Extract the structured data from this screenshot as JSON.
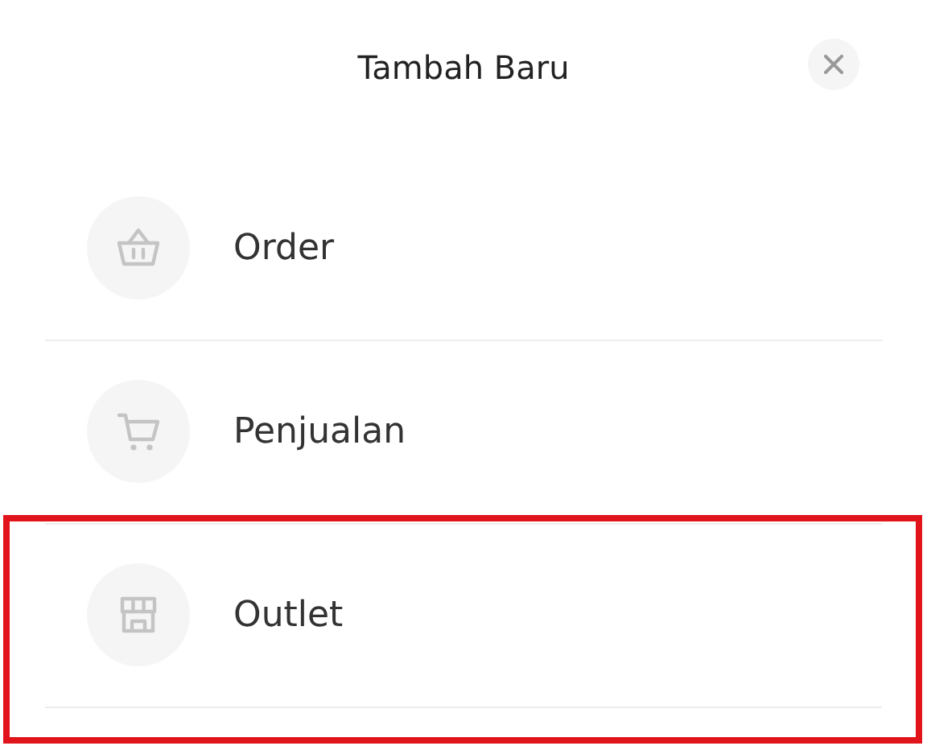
{
  "dialog": {
    "title": "Tambah Baru"
  },
  "items": [
    {
      "kind": "basket",
      "label": "Order",
      "highlighted": false
    },
    {
      "kind": "cart",
      "label": "Penjualan",
      "highlighted": false
    },
    {
      "kind": "store",
      "label": "Outlet",
      "highlighted": true
    }
  ]
}
